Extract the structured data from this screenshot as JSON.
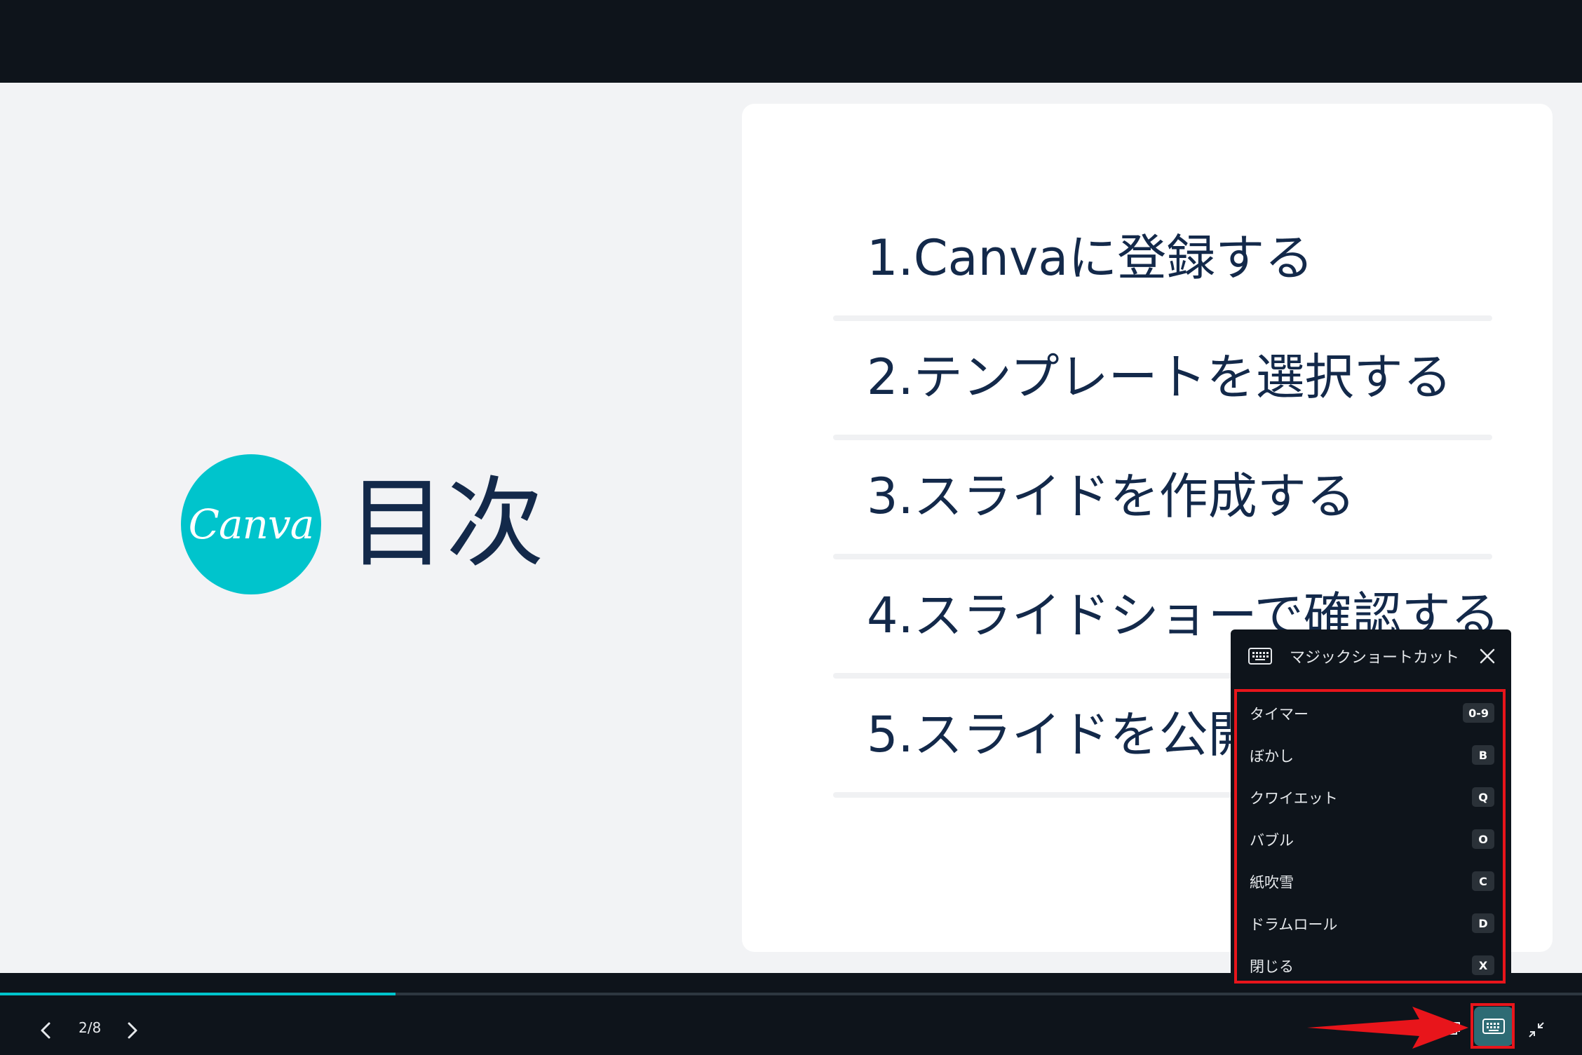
{
  "slide": {
    "logo_text": "Canva",
    "title": "目次",
    "toc": [
      "1.Canvaに登録する",
      "2.テンプレートを選択する",
      "3.スライドを作成する",
      "4.スライドショーで確認する",
      "5.スライドを公開"
    ]
  },
  "controls": {
    "page_counter": "2/8",
    "progress_fraction": 0.25,
    "prev_icon": "chevron-left-icon",
    "next_icon": "chevron-right-icon"
  },
  "shortcut_panel": {
    "title": "マジックショートカット",
    "items": [
      {
        "label": "タイマー",
        "key": "0-9"
      },
      {
        "label": "ぼかし",
        "key": "B"
      },
      {
        "label": "クワイエット",
        "key": "Q"
      },
      {
        "label": "バブル",
        "key": "O"
      },
      {
        "label": "紙吹雪",
        "key": "C"
      },
      {
        "label": "ドラムロール",
        "key": "D"
      },
      {
        "label": "閉じる",
        "key": "X"
      }
    ]
  },
  "colors": {
    "accent": "#00c4cc",
    "highlight": "#e8151b",
    "dark_bg": "#0e141b",
    "text_dark": "#13294a"
  }
}
